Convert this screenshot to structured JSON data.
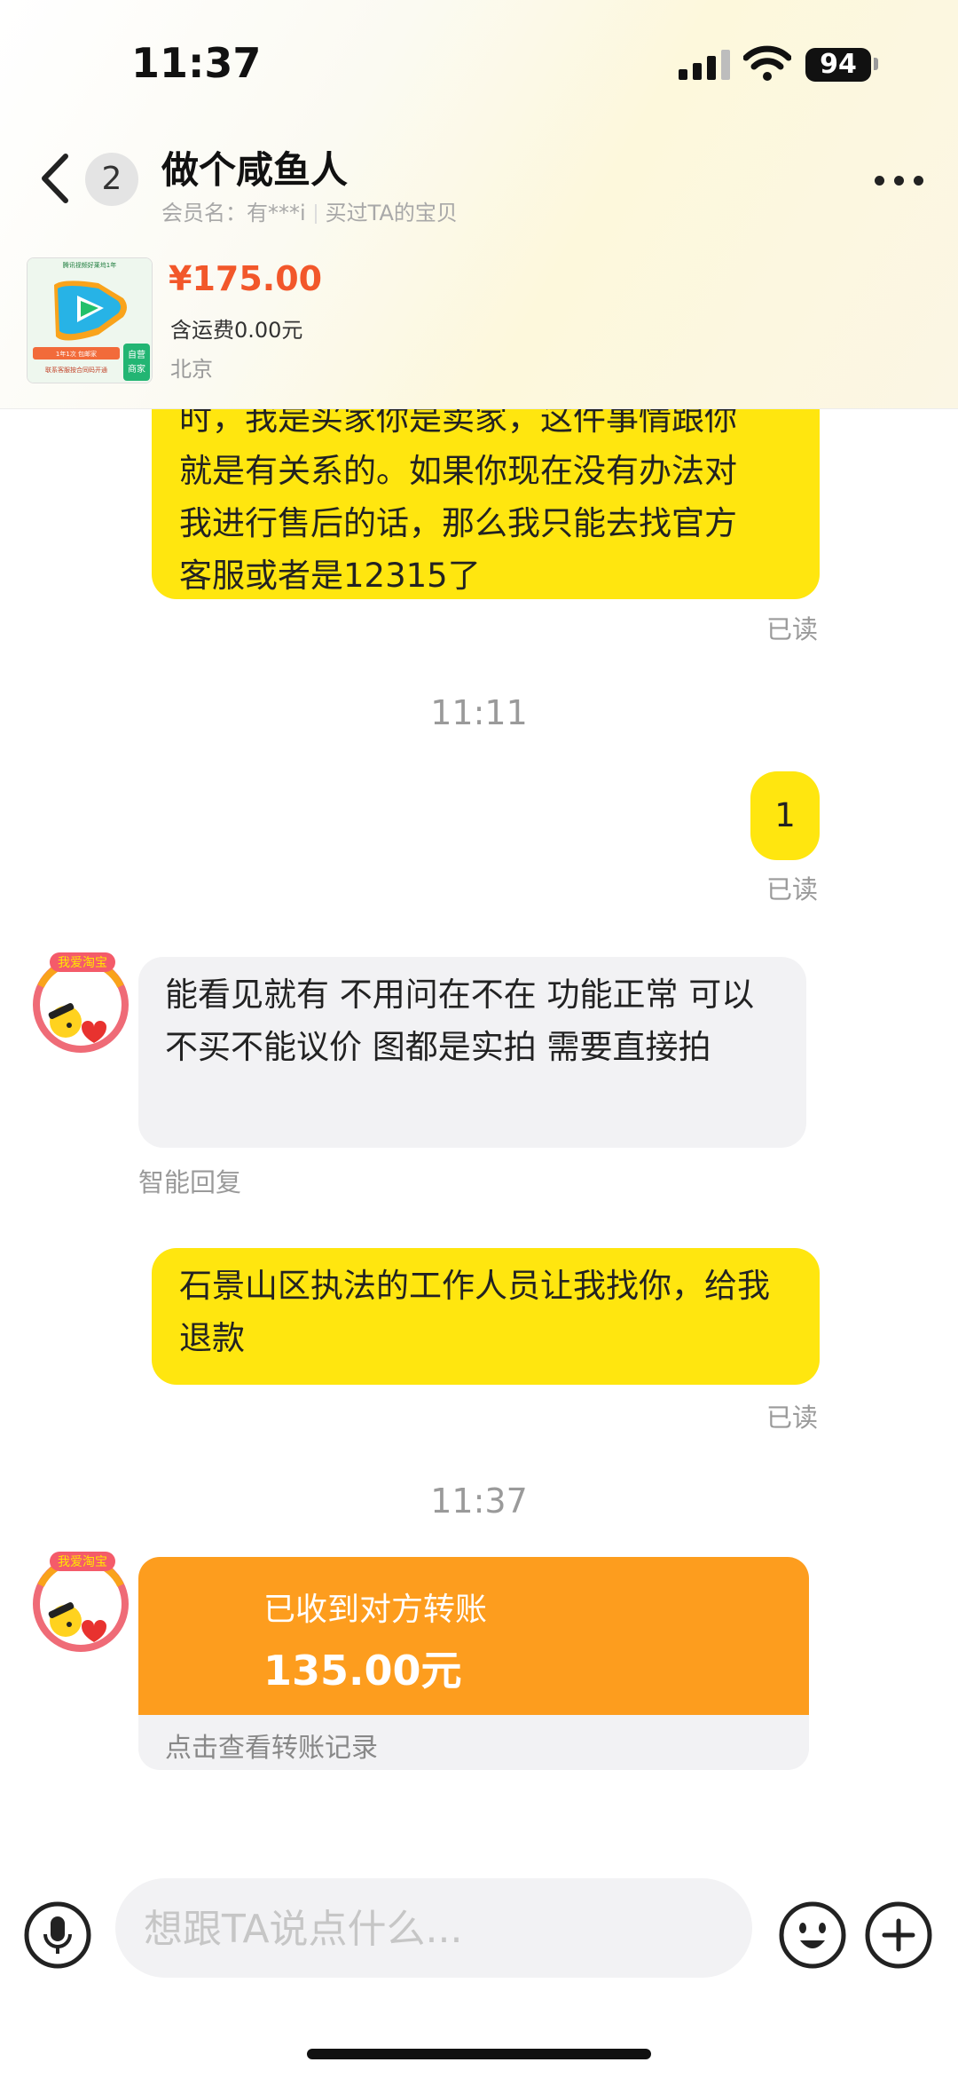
{
  "status_bar": {
    "time": "11:37",
    "battery": "94"
  },
  "header": {
    "unread_count": "2",
    "title": "做个咸鱼人",
    "member_label": "会员名：有***i",
    "bought_label": "买过TA的宝贝"
  },
  "product": {
    "price": "¥175.00",
    "shipping": "含运费0.00元",
    "location": "北京",
    "thumb_texts": [
      "腾讯视频好莱坞1年",
      "1年1次 包邮家",
      "自营",
      "商家",
      "联系客服按合同码开通"
    ]
  },
  "messages": [
    {
      "side": "me",
      "lines": [
        "时，我是买家你是卖家，这件事情跟你",
        "就是有关系的。如果你现在没有办法对",
        "我进行售后的话，那么我只能去找官方",
        "客服或者是12315了"
      ],
      "status": "已读"
    },
    {
      "type": "timestamp",
      "text": "11:11"
    },
    {
      "side": "me",
      "text": "1",
      "status": "已读"
    },
    {
      "side": "other",
      "text": "能看见就有 不用问在不在 功能正常 可以不买不能议价 图都是实拍 需要直接拍",
      "tag": "智能回复"
    },
    {
      "side": "me",
      "text": "石景山区执法的工作人员让我找你，给我退款",
      "status": "已读"
    },
    {
      "type": "timestamp",
      "text": "11:37"
    },
    {
      "side": "other",
      "type": "transfer",
      "label": "已收到对方转账",
      "amount": "135.00元",
      "link": "点击查看转账记录"
    }
  ],
  "avatar_badge": "我爱淘宝",
  "input": {
    "placeholder": "想跟TA说点什么..."
  },
  "colors": {
    "my_bubble": "#ffe60f",
    "other_bubble": "#f2f2f4",
    "price": "#f2572a",
    "transfer": "#fd9d1e"
  }
}
